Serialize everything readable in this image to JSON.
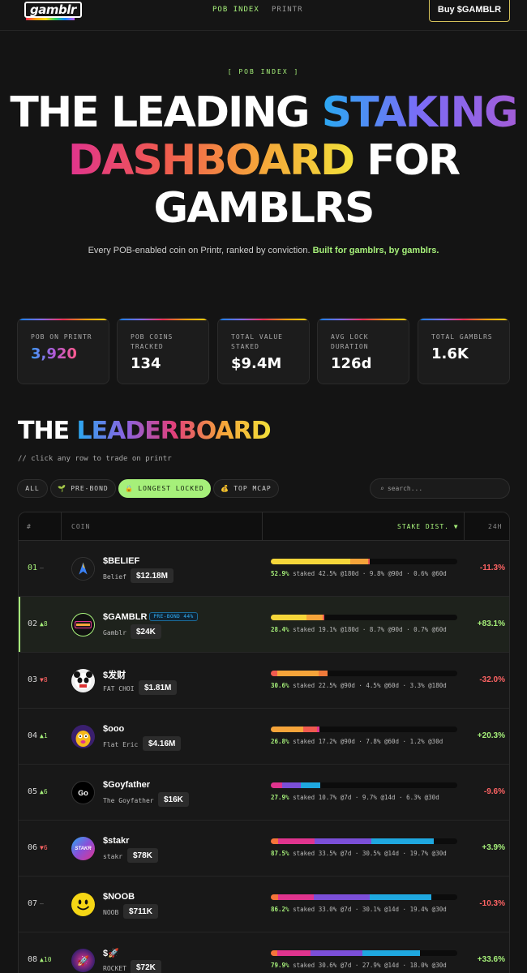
{
  "nav": {
    "logo": "gamblr",
    "links": [
      "POB INDEX",
      "PRINTR"
    ],
    "buy_label": "Buy $GAMBLR"
  },
  "hero": {
    "eyebrow": "[ POB INDEX ]",
    "line1_a": "THE LEADING ",
    "line1_b": "STAKING",
    "line2_a": "DASHBOARD",
    "line2_b": " FOR",
    "line3": "GAMBLRS",
    "subtitle": "Every POB-enabled coin on Printr, ranked by conviction. ",
    "subtitle_highlight": "Built for gamblrs, by gamblrs."
  },
  "stats": [
    {
      "label": "POB ON PRINTR",
      "value": "3,920"
    },
    {
      "label": "POB COINS TRACKED",
      "value": "134"
    },
    {
      "label": "TOTAL VALUE STAKED",
      "value": "$9.4M"
    },
    {
      "label": "AVG LOCK DURATION",
      "value": "126d"
    },
    {
      "label": "TOTAL GAMBLRS",
      "value": "1.6K"
    }
  ],
  "leaderboard": {
    "title_a": "THE ",
    "title_b": "LEADERBOARD",
    "subtitle": "// click any row to trade on printr",
    "filters": [
      {
        "label": "ALL",
        "icon": ""
      },
      {
        "label": "PRE-BOND",
        "icon": "🌱"
      },
      {
        "label": "LONGEST LOCKED",
        "icon": "🔒"
      },
      {
        "label": "TOP MCAP",
        "icon": "💰"
      }
    ],
    "search_placeholder": "search...",
    "search_icon": "⌕",
    "columns": {
      "rank": "#",
      "coin": "COIN",
      "stake": "STAKE DIST. ▼",
      "change": "24H"
    }
  },
  "rows": [
    {
      "rank": "01",
      "move_sym": "–",
      "move": "",
      "ticker": "$BELIEF",
      "tag": "",
      "name": "Belief",
      "mcap": "$12.18M",
      "staked": "52.9%",
      "dist": " staked 42.5% @180d · 9.8% @90d · 0.6% @60d",
      "change": "-11.3%"
    },
    {
      "rank": "02",
      "move_sym": "▲",
      "move": "8",
      "ticker": "$GAMBLR",
      "tag": "PRE-BOND 44%",
      "name": "Gamblr",
      "mcap": "$24K",
      "staked": "28.4%",
      "dist": " staked 19.1% @180d · 8.7% @90d · 0.7% @60d",
      "change": "+83.1%"
    },
    {
      "rank": "03",
      "move_sym": "▼",
      "move": "8",
      "ticker": "$发财",
      "tag": "",
      "name": "FAT CHOI",
      "mcap": "$1.81M",
      "staked": "30.6%",
      "dist": " staked 22.5% @90d · 4.5% @60d · 3.3% @180d",
      "change": "-32.0%"
    },
    {
      "rank": "04",
      "move_sym": "▲",
      "move": "1",
      "ticker": "$ooo",
      "tag": "",
      "name": "Flat Eric",
      "mcap": "$4.16M",
      "staked": "26.8%",
      "dist": " staked  17.2% @90d · 7.8% @60d · 1.2% @30d",
      "change": "+20.3%"
    },
    {
      "rank": "05",
      "move_sym": "▲",
      "move": "6",
      "ticker": "$Goyfather",
      "tag": "",
      "name": "The Goyfather",
      "mcap": "$16K",
      "staked": "27.9%",
      "dist": " staked   10.7% @7d · 9.7% @14d · 6.3% @30d",
      "change": "-9.6%"
    },
    {
      "rank": "06",
      "move_sym": "▼",
      "move": "6",
      "ticker": "$stakr",
      "tag": "",
      "name": "stakr",
      "mcap": "$78K",
      "staked": "87.5%",
      "dist": " staked 33.5% @7d · 30.5% @14d · 19.7% @30d",
      "change": "+3.9%"
    },
    {
      "rank": "07",
      "move_sym": "–",
      "move": "",
      "ticker": "$NOOB",
      "tag": "",
      "name": "NOOB",
      "mcap": "$711K",
      "staked": "86.2%",
      "dist": " staked 33.0% @7d · 30.1% @14d · 19.4% @30d",
      "change": "-10.3%"
    },
    {
      "rank": "08",
      "move_sym": "▲",
      "move": "10",
      "ticker": "$🚀",
      "tag": "",
      "name": "ROCKET",
      "mcap": "$72K",
      "staked": "79.9%",
      "dist": " staked 30.6% @7d · 27.9% @14d · 18.0% @30d",
      "change": "+33.6%"
    }
  ],
  "colors": {
    "accent": "#a6f07a",
    "negative": "#ff6464",
    "gold": "#d4c15a"
  }
}
